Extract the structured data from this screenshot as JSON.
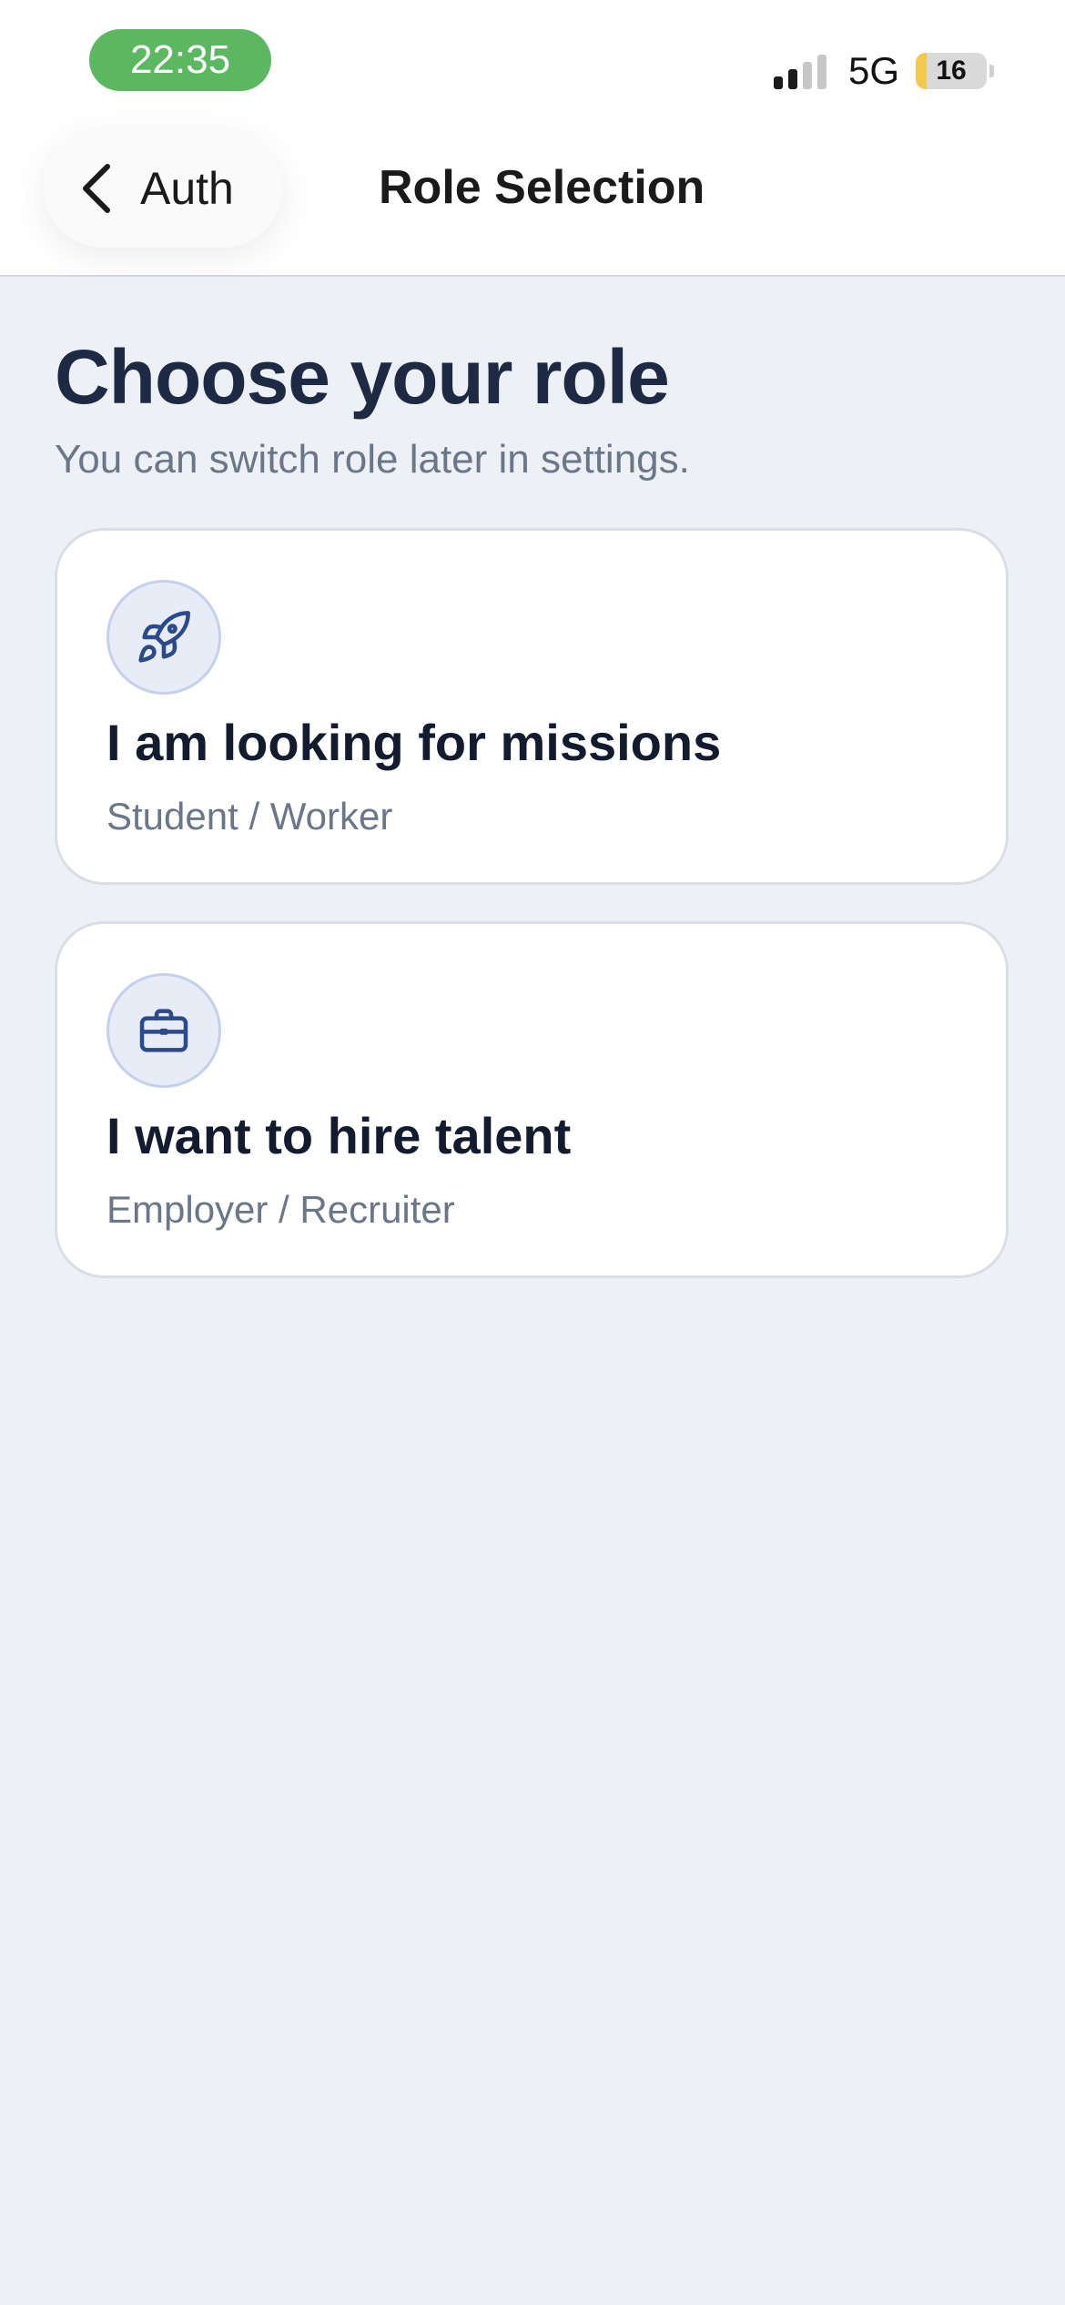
{
  "status_bar": {
    "time": "22:35",
    "network": "5G",
    "battery": "16",
    "signal_bars_active": 2,
    "signal_bars_total": 4,
    "battery_level_percent": 16
  },
  "nav": {
    "back_label": "Auth",
    "title": "Role Selection"
  },
  "page": {
    "heading": "Choose your role",
    "subheading": "You can switch role later in settings."
  },
  "roles": [
    {
      "icon": "rocket-icon",
      "title": "I am looking for missions",
      "subtitle": "Student / Worker"
    },
    {
      "icon": "briefcase-icon",
      "title": "I want to hire talent",
      "subtitle": "Employer / Recruiter"
    }
  ],
  "colors": {
    "background": "#edf0f5",
    "accent": "#2b4a8a",
    "time_pill": "#5cb860",
    "battery_fill": "#f2c94c"
  }
}
